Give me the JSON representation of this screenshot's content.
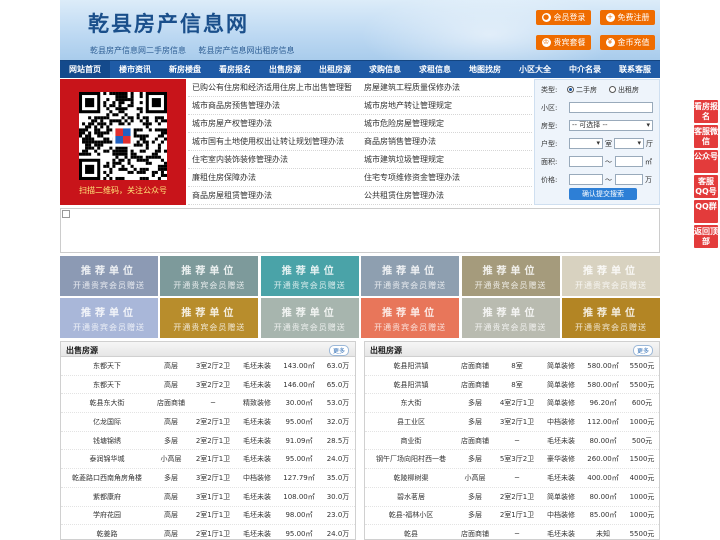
{
  "header": {
    "title": "乾县房产信息网",
    "slogan": [
      "乾县房产信息网二手房信息",
      "乾县房产信息网出租房信息"
    ],
    "buttons": {
      "login": "会员登录",
      "register": "免费注册",
      "package": "贵宾套餐",
      "recharge": "金币充值"
    }
  },
  "nav": [
    "网站首页",
    "楼市资讯",
    "新房楼盘",
    "看房报名",
    "出售房源",
    "出租房源",
    "求购信息",
    "求租信息",
    "地图找房",
    "小区大全",
    "中介名录",
    "联系客服"
  ],
  "qr": {
    "caption": "扫描二维码，关注公众号"
  },
  "links": [
    [
      "已购公有住房和经济适用住房上市出售管理暂",
      "房屋建筑工程质量保修办法"
    ],
    [
      "城市商品房预售管理办法",
      "城市房地产转让管理规定"
    ],
    [
      "城市房屋产权管理办法",
      "城市危险房屋管理规定"
    ],
    [
      "城市国有土地使用权出让转让规划管理办法",
      "商品房销售管理办法"
    ],
    [
      "住宅室内装饰装修管理办法",
      "城市建筑垃圾管理规定"
    ],
    [
      "廉租住房保障办法",
      "住宅专项维修资金管理办法"
    ],
    [
      "商品房屋租赁管理办法",
      "公共租赁住房管理办法"
    ]
  ],
  "search": {
    "type_label": "类型:",
    "type_opt1": "二手房",
    "type_opt2": "出租房",
    "district_label": "小区:",
    "house_label": "房型:",
    "house_value": "-- 可选择 --",
    "layout_label": "户型:",
    "room_value": "",
    "room_unit": "室",
    "hall_unit": "厅",
    "area_label": "面积:",
    "tilde1": "～",
    "area_unit": "㎡",
    "price_label": "价格:",
    "tilde2": "～",
    "price_unit": "万",
    "submit": "确认提交搜索"
  },
  "tiles": [
    {
      "a": "推荐单位",
      "b": "开通贵宾会员赠送",
      "color": "#8c9ab4"
    },
    {
      "a": "推荐单位",
      "b": "开通贵宾会员赠送",
      "color": "#7d9a9b"
    },
    {
      "a": "推荐单位",
      "b": "开通贵宾会员赠送",
      "color": "#4aa3a8"
    },
    {
      "a": "推荐单位",
      "b": "开通贵宾会员赠送",
      "color": "#8e9fb0"
    },
    {
      "a": "推荐单位",
      "b": "开通贵宾会员赠送",
      "color": "#a59b7c"
    },
    {
      "a": "推荐单位",
      "b": "开通贵宾会员赠送",
      "color": "#d8d2c0"
    },
    {
      "a": "推荐单位",
      "b": "开通贵宾会员赠送",
      "color": "#a9b7d9"
    },
    {
      "a": "推荐单位",
      "b": "开通贵宾会员赠送",
      "color": "#b88d2c"
    },
    {
      "a": "推荐单位",
      "b": "开通贵宾会员赠送",
      "color": "#a7b5ae"
    },
    {
      "a": "推荐单位",
      "b": "开通贵宾会员赠送",
      "color": "#e8765a"
    },
    {
      "a": "推荐单位",
      "b": "开通贵宾会员赠送",
      "color": "#b9bbb0"
    },
    {
      "a": "推荐单位",
      "b": "开通贵宾会员赠送",
      "color": "#b38524"
    }
  ],
  "sale": {
    "title": "出售房源",
    "more": "更多",
    "rows": [
      [
        "东都天下",
        "高层",
        "3室2厅2卫",
        "毛坯未装",
        "143.00㎡",
        "63.0万"
      ],
      [
        "东都天下",
        "高层",
        "3室2厅2卫",
        "毛坯未装",
        "146.00㎡",
        "65.0万"
      ],
      [
        "乾县东大街",
        "店面商铺",
        "─",
        "精致装修",
        "30.00㎡",
        "53.0万"
      ],
      [
        "亿龙国际",
        "高层",
        "2室2厅1卫",
        "毛坯未装",
        "95.00㎡",
        "32.0万"
      ],
      [
        "钱塘锦绣",
        "多层",
        "2室2厅1卫",
        "毛坯未装",
        "91.09㎡",
        "28.5万"
      ],
      [
        "泰润锦华城",
        "小高层",
        "2室1厅1卫",
        "毛坯未装",
        "95.00㎡",
        "24.0万"
      ],
      [
        "乾菱路口西南角房角楼",
        "多层",
        "3室2厅1卫",
        "中档装修",
        "127.79㎡",
        "35.0万"
      ],
      [
        "紫都康府",
        "高层",
        "3室1厅1卫",
        "毛坯未装",
        "108.00㎡",
        "30.0万"
      ],
      [
        "学府花园",
        "高层",
        "2室1厅1卫",
        "毛坯未装",
        "98.00㎡",
        "23.0万"
      ],
      [
        "乾姜路",
        "高层",
        "2室1厅1卫",
        "毛坯未装",
        "95.00㎡",
        "24.0万"
      ]
    ]
  },
  "rent": {
    "title": "出租房源",
    "more": "更多",
    "rows": [
      [
        "乾县阳洪镇",
        "店面商铺",
        "8室",
        "简单装修",
        "580.00㎡",
        "5500元"
      ],
      [
        "乾县阳洪镇",
        "店面商铺",
        "8室",
        "简单装修",
        "580.00㎡",
        "5500元"
      ],
      [
        "东大街",
        "多层",
        "4室2厅1卫",
        "简单装修",
        "96.20㎡",
        "600元"
      ],
      [
        "县工业区",
        "多层",
        "3室2厅1卫",
        "中档装修",
        "112.00㎡",
        "1000元"
      ],
      [
        "商业街",
        "店面商铺",
        "─",
        "毛坯未装",
        "80.00㎡",
        "500元"
      ],
      [
        "钢午厂场向阳村西一巷",
        "多层",
        "5室3厅2卫",
        "豪华装修",
        "260.00㎡",
        "1500元"
      ],
      [
        "乾陵柳树渠",
        "小高层",
        "─",
        "毛坯未装",
        "400.00㎡",
        "4000元"
      ],
      [
        "碧水茗居",
        "多层",
        "2室2厅1卫",
        "简单装修",
        "80.00㎡",
        "1000元"
      ],
      [
        "乾县-福林小区",
        "多层",
        "2室1厅1卫",
        "中档装修",
        "85.00㎡",
        "1000元"
      ],
      [
        "乾县",
        "店面商铺",
        "─",
        "毛坯未装",
        "未知",
        "5500元"
      ]
    ]
  },
  "float": [
    "看房报名",
    "客服微信",
    "公众号",
    "客服QQ号",
    "QQ群",
    "返回顶部"
  ]
}
